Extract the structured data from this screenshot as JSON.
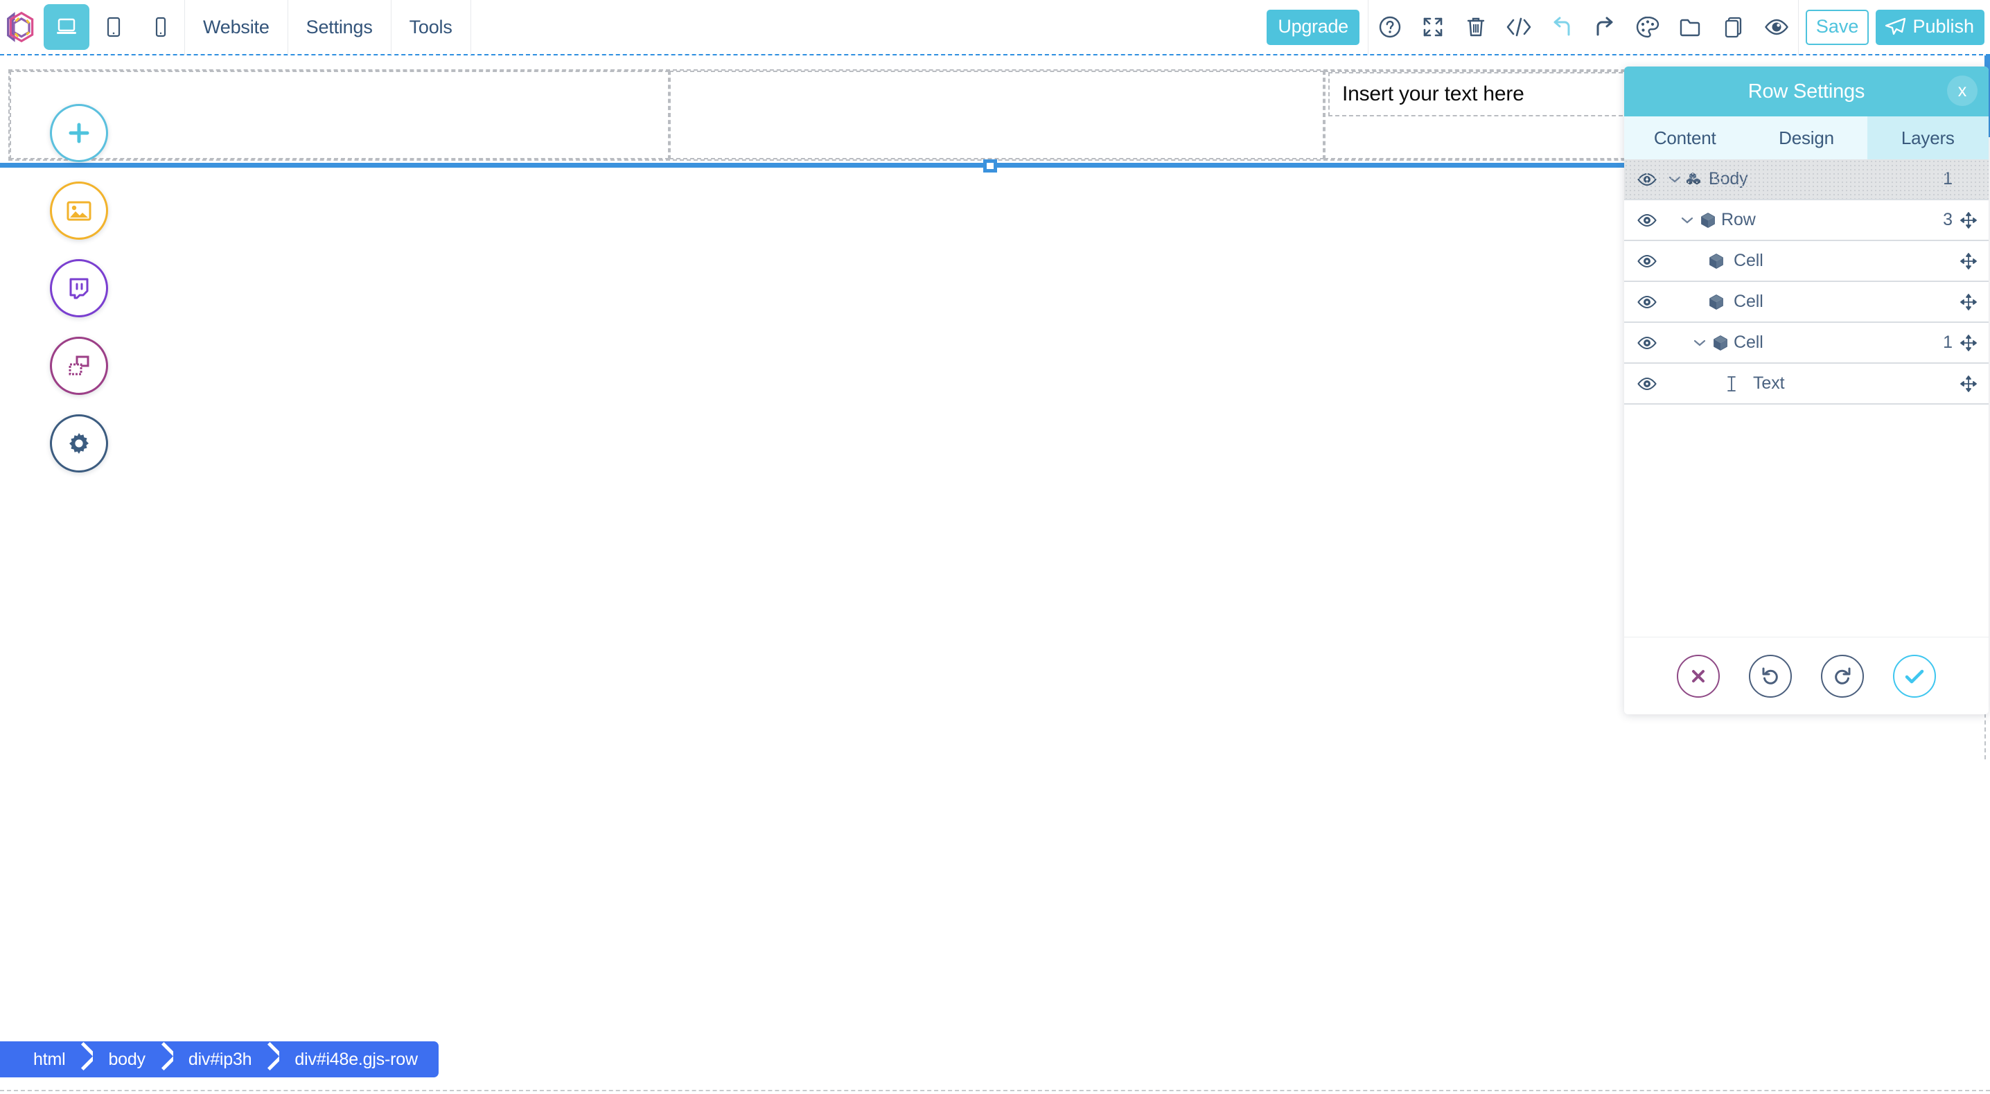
{
  "app": {
    "logo_name": "hexagon-logo",
    "accent_cyan": "#4ec3dd",
    "accent_blue": "#3b92dd",
    "breadcrumb_blue": "#3d6ff0"
  },
  "toolbar": {
    "devices": [
      {
        "name": "desktop",
        "icon": "desktop-icon",
        "active": true
      },
      {
        "name": "tablet",
        "icon": "tablet-icon",
        "active": false
      },
      {
        "name": "mobile",
        "icon": "mobile-icon",
        "active": false
      }
    ],
    "menus": [
      {
        "label": "Website"
      },
      {
        "label": "Settings"
      },
      {
        "label": "Tools"
      }
    ],
    "upgrade_label": "Upgrade",
    "actions": [
      {
        "name": "help-icon"
      },
      {
        "name": "fullscreen-icon"
      },
      {
        "name": "trash-icon"
      },
      {
        "name": "code-icon"
      },
      {
        "name": "undo-icon"
      },
      {
        "name": "redo-icon"
      },
      {
        "name": "palette-icon"
      },
      {
        "name": "folder-icon"
      },
      {
        "name": "pages-icon"
      },
      {
        "name": "preview-eye-icon"
      }
    ],
    "save_label": "Save",
    "publish_label": "Publish"
  },
  "sidebar": {
    "items": [
      {
        "name": "add-block-button",
        "icon": "plus-icon",
        "color": "#5bc0de"
      },
      {
        "name": "image-button",
        "icon": "image-icon",
        "color": "#f2b32c"
      },
      {
        "name": "chat-button",
        "icon": "chat-icon",
        "color": "#7a3fd0"
      },
      {
        "name": "layers-button",
        "icon": "layers-icon",
        "color": "#9c3f87"
      },
      {
        "name": "settings-button",
        "icon": "gear-icon",
        "color": "#3c5c80"
      }
    ]
  },
  "canvas": {
    "row_label": "gjs-row",
    "cells": [
      {
        "name": "cell-1",
        "text": ""
      },
      {
        "name": "cell-2",
        "text": ""
      },
      {
        "name": "cell-3",
        "text": "Insert your text here"
      }
    ]
  },
  "panel": {
    "title": "Row Settings",
    "close_label": "x",
    "tabs": [
      {
        "label": "Content",
        "active": false
      },
      {
        "label": "Design",
        "active": false
      },
      {
        "label": "Layers",
        "active": true
      }
    ],
    "layers": [
      {
        "name": "Body",
        "type": "blocks-icon",
        "count": "1",
        "indent": 1,
        "caret": true,
        "selected": true,
        "move": false
      },
      {
        "name": "Row",
        "type": "box-icon",
        "count": "3",
        "indent": 1,
        "caret": true,
        "selected": false,
        "move": true
      },
      {
        "name": "Cell",
        "type": "box-icon",
        "count": "",
        "indent": 2,
        "caret": false,
        "selected": false,
        "move": true
      },
      {
        "name": "Cell",
        "type": "box-icon",
        "count": "",
        "indent": 2,
        "caret": false,
        "selected": false,
        "move": true
      },
      {
        "name": "Cell",
        "type": "box-icon",
        "count": "1",
        "indent": 2,
        "caret": true,
        "selected": false,
        "move": true
      },
      {
        "name": "Text",
        "type": "text-cursor-icon",
        "count": "",
        "indent": 3,
        "caret": false,
        "selected": false,
        "move": true
      }
    ],
    "footer_buttons": [
      {
        "name": "cancel-button",
        "icon": "x-icon",
        "color": "#8f4a86"
      },
      {
        "name": "undo-button",
        "icon": "undo-arrow-icon",
        "color": "#4b5f7d"
      },
      {
        "name": "redo-button",
        "icon": "redo-arrow-icon",
        "color": "#4b5f7d"
      },
      {
        "name": "confirm-button",
        "icon": "check-icon",
        "color": "#3fc6ef"
      }
    ]
  },
  "breadcrumb": {
    "items": [
      {
        "label": "html"
      },
      {
        "label": "body"
      },
      {
        "label": "div#ip3h"
      },
      {
        "label": "div#i48e.gjs-row"
      }
    ]
  }
}
